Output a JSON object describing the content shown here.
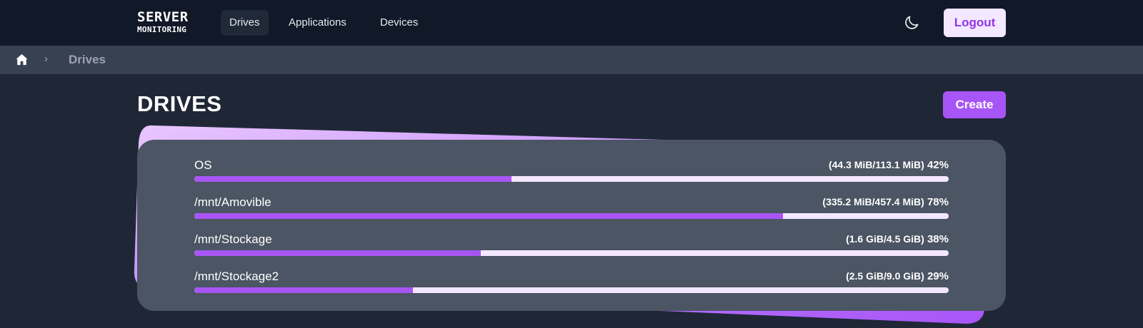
{
  "navbar": {
    "logo_line1": "SERVER",
    "logo_line2": "MONITORING",
    "links": [
      {
        "label": "Drives",
        "active": true
      },
      {
        "label": "Applications",
        "active": false
      },
      {
        "label": "Devices",
        "active": false
      }
    ],
    "theme_icon": "moon-icon",
    "logout_label": "Logout"
  },
  "breadcrumb": {
    "home_icon": "home-icon",
    "separator": "›",
    "current": "Drives"
  },
  "page": {
    "title": "DRIVES",
    "create_label": "Create"
  },
  "colors": {
    "accent": "#a855f7",
    "track": "#f3e8ff",
    "card": "#4b5563",
    "background": "#1f2737",
    "navbar": "#111827"
  },
  "drives": [
    {
      "name": "OS",
      "size": "(44.3 MiB/113.1 MiB)",
      "percent_label": "42%",
      "bar_fill": 0.42
    },
    {
      "name": "/mnt/Amovible",
      "size": "(335.2 MiB/457.4 MiB)",
      "percent_label": "78%",
      "bar_fill": 0.78
    },
    {
      "name": "/mnt/Stockage",
      "size": "(1.6 GiB/4.5 GiB)",
      "percent_label": "38%",
      "bar_fill": 0.38
    },
    {
      "name": "/mnt/Stockage2",
      "size": "(2.5 GiB/9.0 GiB)",
      "percent_label": "29%",
      "bar_fill": 0.29
    }
  ]
}
